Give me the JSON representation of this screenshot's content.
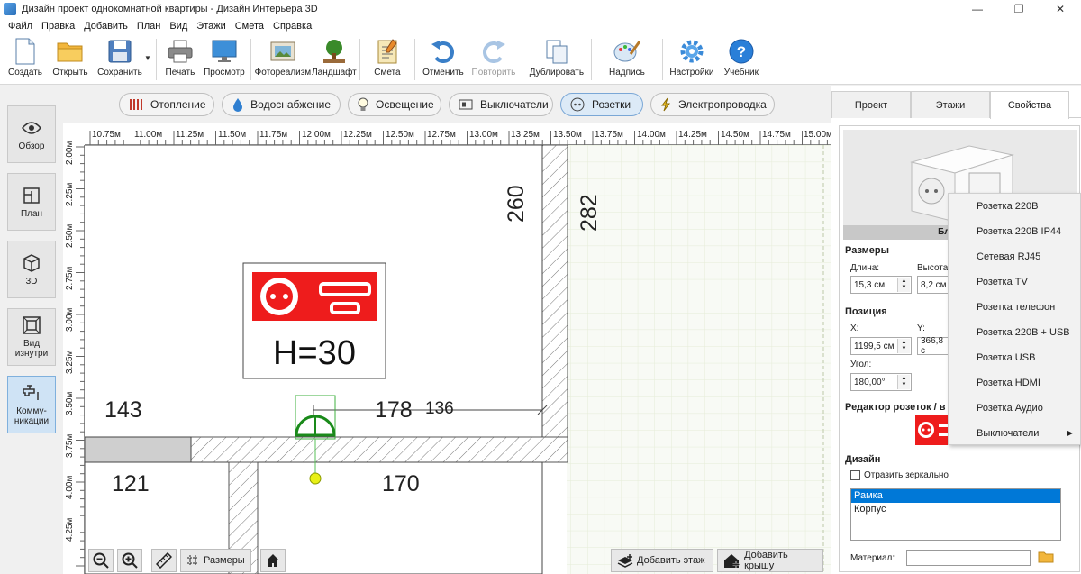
{
  "window": {
    "title": "Дизайн проект однокомнатной квартиры - Дизайн Интерьера 3D",
    "minimize": "—",
    "maximize": "❐",
    "close": "✕"
  },
  "menu": [
    "Файл",
    "Правка",
    "Добавить",
    "План",
    "Вид",
    "Этажи",
    "Смета",
    "Справка"
  ],
  "toolbar": {
    "create": "Создать",
    "open": "Открыть",
    "save": "Сохранить",
    "print": "Печать",
    "preview": "Просмотр",
    "photorealism": "Фотореализм",
    "landscape": "Ландшафт",
    "estimate": "Смета",
    "undo": "Отменить",
    "redo": "Повторить",
    "duplicate": "Дублировать",
    "label": "Надпись",
    "settings": "Настройки",
    "tutorial": "Учебник"
  },
  "sidebar": {
    "overview": "Обзор",
    "plan": "План",
    "view3d": "3D",
    "inside_view": "Вид изнутри",
    "communications": "Комму-никации"
  },
  "categories": [
    "Отопление",
    "Водоснабжение",
    "Освещение",
    "Выключатели",
    "Розетки",
    "Электропроводка"
  ],
  "ruler": {
    "x": [
      "10.75м",
      "11.00м",
      "11.25м",
      "11.50м",
      "11.75м",
      "12.00м",
      "12.25м",
      "12.50м",
      "12.75м",
      "13.00м",
      "13.25м",
      "13.50м",
      "13.75м",
      "14.00м",
      "14.25м",
      "14.50м",
      "14.75м",
      "15.00м"
    ],
    "y": [
      "2.00м",
      "2.25м",
      "2.50м",
      "2.75м",
      "3.00м",
      "3.25м",
      "3.50м",
      "3.75м",
      "4.00м",
      "4.25м"
    ]
  },
  "plan": {
    "dim_260": "260",
    "dim_282": "282",
    "dim_143": "143",
    "dim_178": "178",
    "dim_136": "136",
    "dim_121": "121",
    "dim_170": "170",
    "height_label": "H=30"
  },
  "canvas_buttons": {
    "sizes": "Размеры",
    "add_floor": "Добавить этаж",
    "add_roof": "Добавить крышу"
  },
  "right_panel": {
    "tabs": [
      "Проект",
      "Этажи",
      "Свойства"
    ],
    "preview_caption": "Блок розе",
    "sizes_title": "Размеры",
    "length_label": "Длина:",
    "length_value": "15,3 см",
    "height_label": "Высота",
    "height_value": "8,2 см",
    "position_title": "Позиция",
    "x_label": "X:",
    "x_value": "1199,5 см",
    "y_label": "Y:",
    "y_value": "366,8 с",
    "angle_label": "Угол:",
    "angle_value": "180,00°",
    "editor_title": "Редактор розеток / в",
    "design_title": "Дизайн",
    "mirror_label": "Отразить зеркально",
    "list": [
      "Рамка",
      "Корпус"
    ],
    "material_label": "Материал:"
  },
  "context_menu": [
    "Розетка 220В",
    "Розетка 220В IP44",
    "Сетевая RJ45",
    "Розетка TV",
    "Розетка телефон",
    "Розетка 220В + USB",
    "Розетка USB",
    "Розетка HDMI",
    "Розетка Аудио",
    "Выключатели"
  ],
  "colors": {
    "socket_red": "#ee1c1c",
    "active_blue": "#0078d7",
    "wall_stroke": "#444444",
    "marker_green": "#1a8a1a"
  }
}
